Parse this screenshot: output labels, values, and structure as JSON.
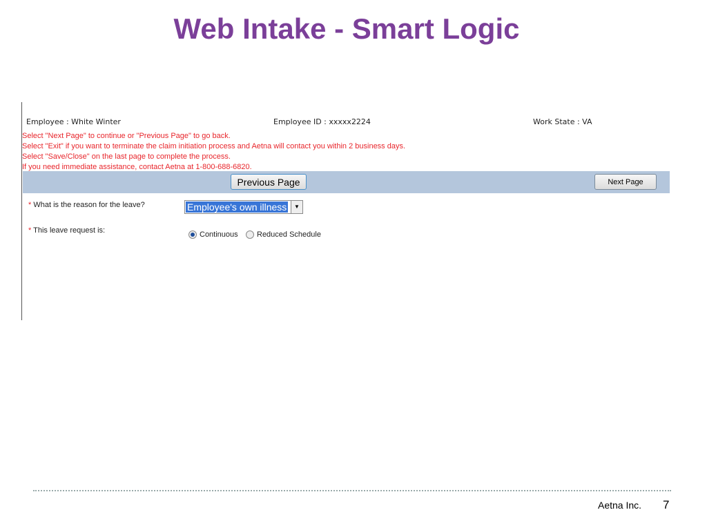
{
  "title": "Web Intake - Smart Logic",
  "header": {
    "employee": "Employee : White Winter",
    "employee_id": "Employee ID : xxxxx2224",
    "work_state": "Work State : VA"
  },
  "messages": [
    "Select \"Next Page\" to continue or \"Previous Page\" to go back.",
    "Select \"Exit\" if you want to terminate the claim initiation process and Aetna will contact you within 2 business days.",
    "Select \"Save/Close\" on the last page to complete the process.",
    "If you need immediate assistance, contact Aetna at 1-800-688-6820."
  ],
  "buttons": {
    "previous": "Previous Page",
    "next": "Next Page"
  },
  "form": {
    "required_mark": "*",
    "reason_label": "What is the reason for the leave?",
    "reason_value": "Employee's own illness",
    "request_label": "This leave request is:",
    "options": [
      "Continuous",
      "Reduced Schedule"
    ],
    "selected": "Continuous"
  },
  "footer": {
    "company": "Aetna Inc.",
    "page": "7"
  }
}
